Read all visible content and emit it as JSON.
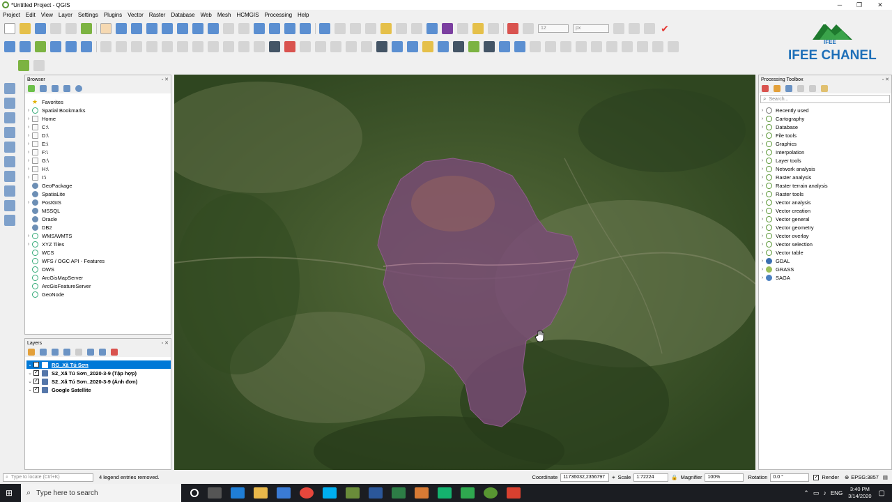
{
  "window": {
    "title": "*Untitled Project - QGIS"
  },
  "menu": [
    "Project",
    "Edit",
    "View",
    "Layer",
    "Settings",
    "Plugins",
    "Vector",
    "Raster",
    "Database",
    "Web",
    "Mesh",
    "HCMGIS",
    "Processing",
    "Help"
  ],
  "toolbar": {
    "font_size_value": "12",
    "font_unit": "px"
  },
  "watermark": {
    "text": "IFEE CHANEL",
    "logo_text": "IFEE"
  },
  "browser": {
    "title": "Browser",
    "items": [
      {
        "label": "Favorites",
        "icon": "star-icon",
        "expand": false
      },
      {
        "label": "Spatial Bookmarks",
        "icon": "bookmark-icon",
        "expand": true
      },
      {
        "label": "Home",
        "icon": "folder-icon",
        "expand": true
      },
      {
        "label": "C:\\",
        "icon": "folder-icon",
        "expand": true
      },
      {
        "label": "D:\\",
        "icon": "folder-icon",
        "expand": true
      },
      {
        "label": "E:\\",
        "icon": "folder-icon",
        "expand": true
      },
      {
        "label": "F:\\",
        "icon": "folder-icon",
        "expand": true
      },
      {
        "label": "G:\\",
        "icon": "folder-icon",
        "expand": true
      },
      {
        "label": "H:\\",
        "icon": "folder-icon",
        "expand": true
      },
      {
        "label": "I:\\",
        "icon": "folder-icon",
        "expand": true
      },
      {
        "label": "GeoPackage",
        "icon": "geopackage-icon",
        "expand": false
      },
      {
        "label": "SpatiaLite",
        "icon": "spatialite-icon",
        "expand": false
      },
      {
        "label": "PostGIS",
        "icon": "postgis-icon",
        "expand": true
      },
      {
        "label": "MSSQL",
        "icon": "mssql-icon",
        "expand": false
      },
      {
        "label": "Oracle",
        "icon": "oracle-icon",
        "expand": false
      },
      {
        "label": "DB2",
        "icon": "db2-icon",
        "expand": false
      },
      {
        "label": "WMS/WMTS",
        "icon": "wms-icon",
        "expand": true
      },
      {
        "label": "XYZ Tiles",
        "icon": "xyz-icon",
        "expand": true
      },
      {
        "label": "WCS",
        "icon": "wcs-icon",
        "expand": false
      },
      {
        "label": "WFS / OGC API - Features",
        "icon": "wfs-icon",
        "expand": false
      },
      {
        "label": "OWS",
        "icon": "ows-icon",
        "expand": false
      },
      {
        "label": "ArcGisMapServer",
        "icon": "arcgis-map-icon",
        "expand": false
      },
      {
        "label": "ArcGisFeatureServer",
        "icon": "arcgis-feature-icon",
        "expand": false
      },
      {
        "label": "GeoNode",
        "icon": "geonode-icon",
        "expand": false
      }
    ]
  },
  "layers": {
    "title": "Layers",
    "items": [
      {
        "label": "RG_Xã Tú Sơn",
        "checked": true,
        "selected": true
      },
      {
        "label": "S2_Xã Tú Sơn_2020-3-9 (Tập hợp)",
        "checked": true,
        "selected": false
      },
      {
        "label": "S2_Xã Tú Sơn_2020-3-9 (Ảnh đơn)",
        "checked": true,
        "selected": false
      },
      {
        "label": "Google Satellite",
        "checked": true,
        "selected": false
      }
    ]
  },
  "processing": {
    "title": "Processing Toolbox",
    "search_placeholder": "Search...",
    "items": [
      {
        "label": "Recently used",
        "icon": "clock-icon"
      },
      {
        "label": "Cartography",
        "icon": "qgis-icon"
      },
      {
        "label": "Database",
        "icon": "qgis-icon"
      },
      {
        "label": "File tools",
        "icon": "qgis-icon"
      },
      {
        "label": "Graphics",
        "icon": "qgis-icon"
      },
      {
        "label": "Interpolation",
        "icon": "qgis-icon"
      },
      {
        "label": "Layer tools",
        "icon": "qgis-icon"
      },
      {
        "label": "Network analysis",
        "icon": "qgis-icon"
      },
      {
        "label": "Raster analysis",
        "icon": "qgis-icon"
      },
      {
        "label": "Raster terrain analysis",
        "icon": "qgis-icon"
      },
      {
        "label": "Raster tools",
        "icon": "qgis-icon"
      },
      {
        "label": "Vector analysis",
        "icon": "qgis-icon"
      },
      {
        "label": "Vector creation",
        "icon": "qgis-icon"
      },
      {
        "label": "Vector general",
        "icon": "qgis-icon"
      },
      {
        "label": "Vector geometry",
        "icon": "qgis-icon"
      },
      {
        "label": "Vector overlay",
        "icon": "qgis-icon"
      },
      {
        "label": "Vector selection",
        "icon": "qgis-icon"
      },
      {
        "label": "Vector table",
        "icon": "qgis-icon"
      },
      {
        "label": "GDAL",
        "icon": "gdal-icon"
      },
      {
        "label": "GRASS",
        "icon": "grass-icon"
      },
      {
        "label": "SAGA",
        "icon": "saga-icon"
      }
    ]
  },
  "status": {
    "locate_placeholder": "Type to locate (Ctrl+K)",
    "message": "4 legend entries removed.",
    "coordinate_label": "Coordinate",
    "coordinate_value": "11736032,2356797",
    "scale_label": "Scale",
    "scale_value": "1:72224",
    "magnifier_label": "Magnifier",
    "magnifier_value": "100%",
    "rotation_label": "Rotation",
    "rotation_value": "0.0 °",
    "render_label": "Render",
    "crs": "EPSG:3857"
  },
  "taskbar": {
    "search_placeholder": "Type here to search",
    "language": "ENG",
    "time": "3:40 PM",
    "date": "3/14/2020"
  },
  "colors": {
    "selection": "#0078d7",
    "polygon_fill": "#7a4a78",
    "qgis_green": "#589632",
    "taskbar": "#1b1d22"
  }
}
